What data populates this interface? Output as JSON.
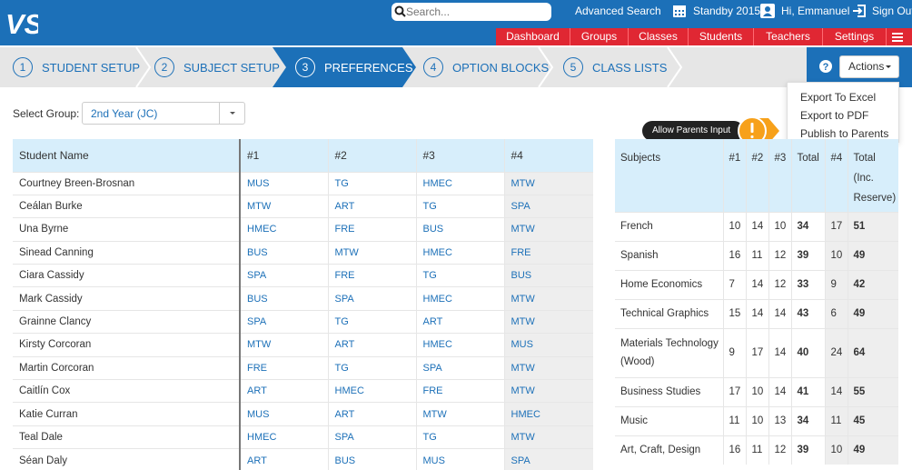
{
  "header": {
    "logo_text": "VS",
    "search_placeholder": "Search...",
    "advanced_search": "Advanced Search",
    "standby": "Standby 2015",
    "user": "Hi, Emmanuel",
    "signout": "Sign Out",
    "icons": [
      "search-icon",
      "calendar-icon",
      "user-icon",
      "signout-icon"
    ]
  },
  "nav": {
    "items": [
      "Dashboard",
      "Groups",
      "Classes",
      "Students",
      "Teachers",
      "Settings"
    ],
    "menu_icon": "hamburger-icon"
  },
  "steps": [
    {
      "num": "1",
      "label": "STUDENT SETUP"
    },
    {
      "num": "2",
      "label": "SUBJECT SETUP"
    },
    {
      "num": "3",
      "label": "PREFERENCES"
    },
    {
      "num": "4",
      "label": "OPTION BLOCKS"
    },
    {
      "num": "5",
      "label": "CLASS LISTS"
    }
  ],
  "active_step": "3",
  "actions": {
    "label": "Actions",
    "help_icon": "help-icon",
    "menu": [
      "Export To Excel",
      "Export to PDF",
      "Publish to Parents"
    ]
  },
  "select_group": {
    "label": "Select Group:",
    "value": "2nd Year (JC)"
  },
  "allow_parents": {
    "label": "Allow Parents Input",
    "icon": "warning-icon"
  },
  "students_table": {
    "headers": [
      "Student Name",
      "#1",
      "#2",
      "#3",
      "#4"
    ],
    "rows": [
      [
        "Courtney Breen-Brosnan",
        "MUS",
        "TG",
        "HMEC",
        "MTW"
      ],
      [
        "Ceálan Burke",
        "MTW",
        "ART",
        "TG",
        "SPA"
      ],
      [
        "Una Byrne",
        "HMEC",
        "FRE",
        "BUS",
        "MTW"
      ],
      [
        "Sinead Canning",
        "BUS",
        "MTW",
        "HMEC",
        "FRE"
      ],
      [
        "Ciara Cassidy",
        "SPA",
        "FRE",
        "TG",
        "BUS"
      ],
      [
        "Mark Cassidy",
        "BUS",
        "SPA",
        "HMEC",
        "MTW"
      ],
      [
        "Grainne Clancy",
        "SPA",
        "TG",
        "ART",
        "MTW"
      ],
      [
        "Kirsty Corcoran",
        "MTW",
        "ART",
        "HMEC",
        "MUS"
      ],
      [
        "Martin Corcoran",
        "FRE",
        "TG",
        "SPA",
        "MTW"
      ],
      [
        "Caitlín Cox",
        "ART",
        "HMEC",
        "FRE",
        "MTW"
      ],
      [
        "Katie Curran",
        "MUS",
        "ART",
        "MTW",
        "HMEC"
      ],
      [
        "Teal Dale",
        "HMEC",
        "SPA",
        "TG",
        "MTW"
      ],
      [
        "Séan Daly",
        "ART",
        "BUS",
        "MUS",
        "SPA"
      ]
    ]
  },
  "subjects_table": {
    "headers": [
      "Subjects",
      "#1",
      "#2",
      "#3",
      "Total",
      "#4",
      "Total (Inc. Reserve)"
    ],
    "rows": [
      [
        "French",
        "10",
        "14",
        "10",
        "34",
        "17",
        "51"
      ],
      [
        "Spanish",
        "16",
        "11",
        "12",
        "39",
        "10",
        "49"
      ],
      [
        "Home Economics",
        "7",
        "14",
        "12",
        "33",
        "9",
        "42"
      ],
      [
        "Technical Graphics",
        "15",
        "14",
        "14",
        "43",
        "6",
        "49"
      ],
      [
        "Materials Technology (Wood)",
        "9",
        "17",
        "14",
        "40",
        "24",
        "64"
      ],
      [
        "Business Studies",
        "17",
        "10",
        "14",
        "41",
        "14",
        "55"
      ],
      [
        "Music",
        "11",
        "10",
        "13",
        "34",
        "11",
        "45"
      ],
      [
        "Art, Craft, Design",
        "16",
        "11",
        "12",
        "39",
        "10",
        "49"
      ]
    ]
  },
  "colors": {
    "primary": "#1c70b8",
    "nav_red": "#e02733",
    "header_cell": "#d7eefb",
    "warning": "#f7a11a"
  }
}
